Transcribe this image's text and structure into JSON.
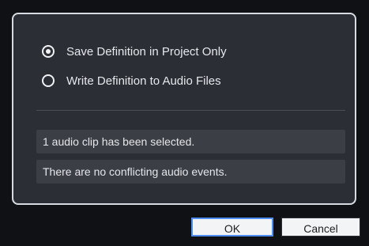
{
  "options": {
    "save_definition_project_label": "Save Definition in Project Only",
    "write_definition_audio_label": "Write Definition to Audio Files",
    "selected_option": "save_definition_project"
  },
  "info": {
    "selected_message": "1 audio clip has been selected.",
    "conflict_message": "There are no conflicting audio events."
  },
  "buttons": {
    "ok_label": "OK",
    "cancel_label": "Cancel"
  }
}
